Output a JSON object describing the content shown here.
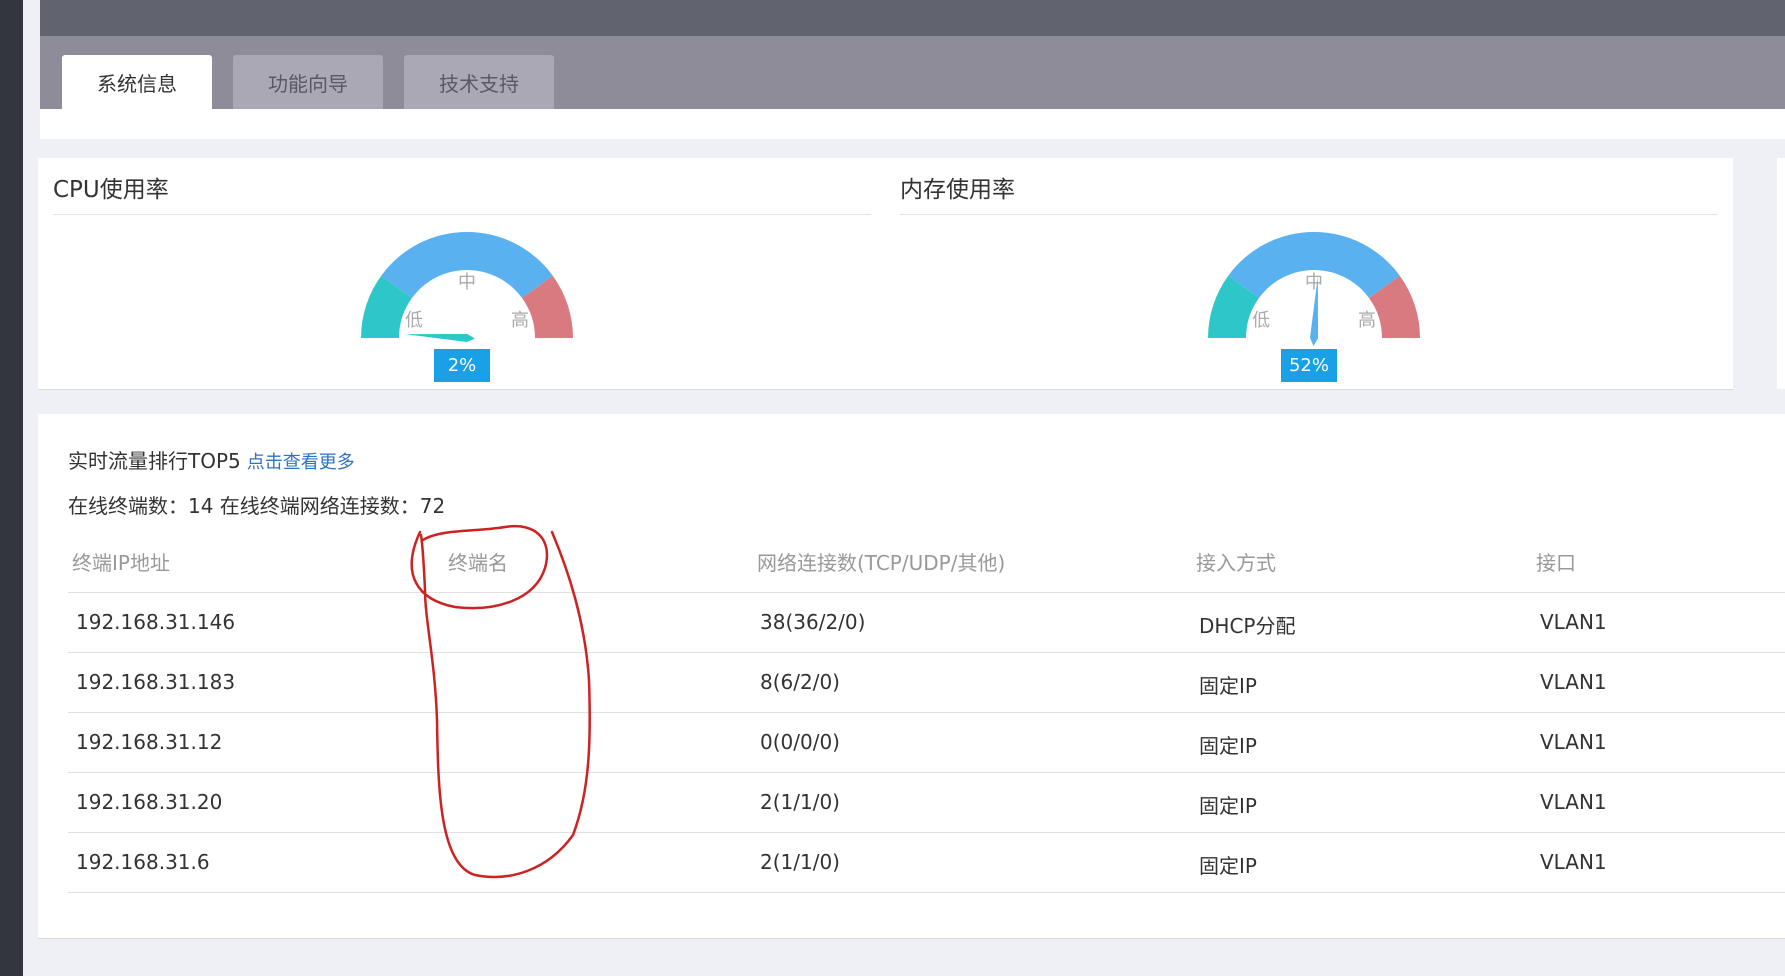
{
  "tabs": [
    {
      "label": "系统信息",
      "active": true
    },
    {
      "label": "功能向导",
      "active": false
    },
    {
      "label": "技术支持",
      "active": false
    }
  ],
  "cpu": {
    "title": "CPU使用率",
    "value_text": "2%",
    "value": 2
  },
  "memory": {
    "title": "内存使用率",
    "value_text": "52%",
    "value": 52
  },
  "gauge_labels": {
    "low": "低",
    "mid": "中",
    "high": "高"
  },
  "gauge_colors": {
    "low": "#2ec7c9",
    "mid": "#5ab1ef",
    "high": "#d87a80",
    "needle_cpu": "#2ec7c9",
    "needle_mem": "#5ab1ef",
    "badge": "#1aa0e6"
  },
  "traffic": {
    "title": "实时流量排行TOP5",
    "more_link": "点击查看更多",
    "summary": "在线终端数：14 在线终端网络连接数：72",
    "columns": [
      "终端IP地址",
      "终端名",
      "网络连接数(TCP/UDP/其他)",
      "接入方式",
      "接口"
    ],
    "rows": [
      [
        "192.168.31.146",
        "",
        "38(36/2/0)",
        "DHCP分配",
        "VLAN1"
      ],
      [
        "192.168.31.183",
        "",
        "8(6/2/0)",
        "固定IP",
        "VLAN1"
      ],
      [
        "192.168.31.12",
        "",
        "0(0/0/0)",
        "固定IP",
        "VLAN1"
      ],
      [
        "192.168.31.20",
        "",
        "2(1/1/0)",
        "固定IP",
        "VLAN1"
      ],
      [
        "192.168.31.6",
        "",
        "2(1/1/0)",
        "固定IP",
        "VLAN1"
      ]
    ]
  },
  "annotation_color": "#cc2222"
}
